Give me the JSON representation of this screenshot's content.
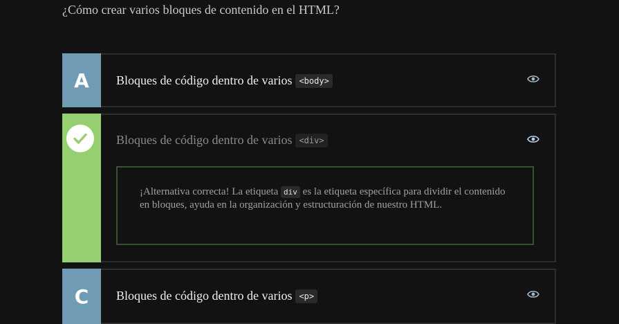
{
  "question": "¿Cómo crear varios bloques de contenido en el HTML?",
  "options": [
    {
      "letter": "A",
      "text": "Bloques de código dentro de varios",
      "code": "<body>"
    },
    {
      "letter": "",
      "text": "Bloques de código dentro de varios",
      "code": "<div>",
      "state": "correct",
      "feedback": {
        "part1": "¡Alternativa correcta! La etiqueta",
        "code": "div",
        "part2": "es la etiqueta específica para dividir el contenido en bloques, ayuda en la organización y estructuración de nuestro HTML."
      }
    },
    {
      "letter": "C",
      "text": "Bloques de código dentro de varios",
      "code": "<p>"
    }
  ],
  "colors": {
    "accent_blue": "#6f9bb5",
    "correct_green": "#95cf6f",
    "feedback_border": "#3a5233"
  },
  "icons": {
    "reveal": "eye-icon",
    "correct": "check-circle-icon"
  }
}
